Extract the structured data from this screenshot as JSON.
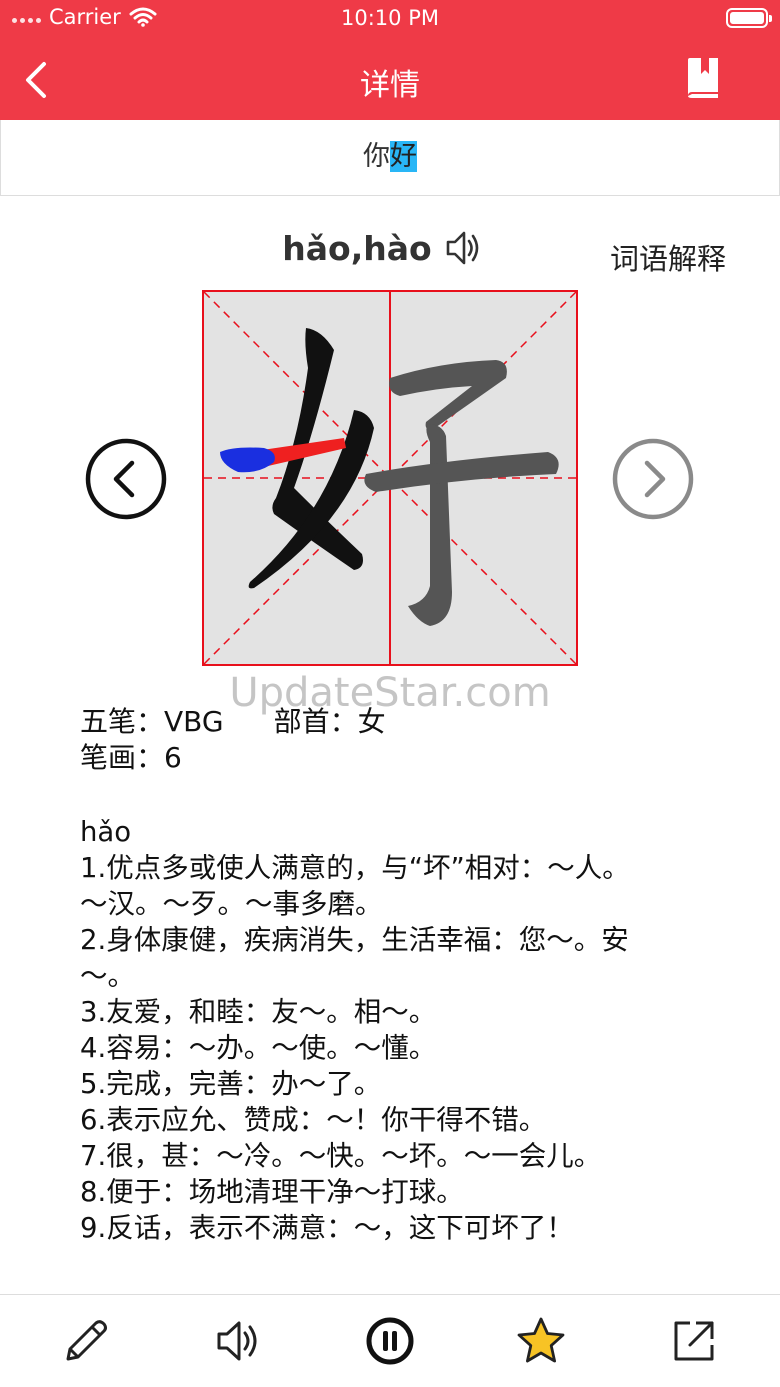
{
  "status_bar": {
    "carrier": "Carrier",
    "time": "10:10 PM"
  },
  "nav": {
    "title": "详情",
    "back_icon": "chevron-left-icon",
    "book_icon": "bookmark-icon"
  },
  "word": {
    "prefix": "你",
    "highlight": "好"
  },
  "pinyin": "hǎo,hào",
  "explain_link": "词语解释",
  "character": "好",
  "watermark": "UpdateStar.com",
  "info": {
    "wubi_label": "五笔：",
    "wubi_value": "VBG",
    "radical_label": "部首：",
    "radical_value": "女",
    "strokes_label": "笔画：",
    "strokes_value": "6"
  },
  "definitions": [
    "hǎo",
    "1.优点多或使人满意的，与“坏”相对：～人。",
    "～汉。～歹。～事多磨。",
    "2.身体康健，疾病消失，生活幸福：您～。安",
    "～。",
    "3.友爱，和睦：友～。相～。",
    "4.容易：～办。～使。～懂。",
    "5.完成，完善：办～了。",
    "6.表示应允、赞成：～！你干得不错。",
    "7.很，甚：～冷。～快。～坏。～一会儿。",
    "8.便于：场地清理干净～打球。",
    "9.反话，表示不满意：～，这下可坏了！"
  ],
  "colors": {
    "accent": "#ef3a47",
    "highlight": "#29b6f6",
    "grid": "#e8101c"
  },
  "toolbar": [
    "pencil-icon",
    "speaker-icon",
    "pause-icon",
    "star-icon",
    "share-icon"
  ]
}
